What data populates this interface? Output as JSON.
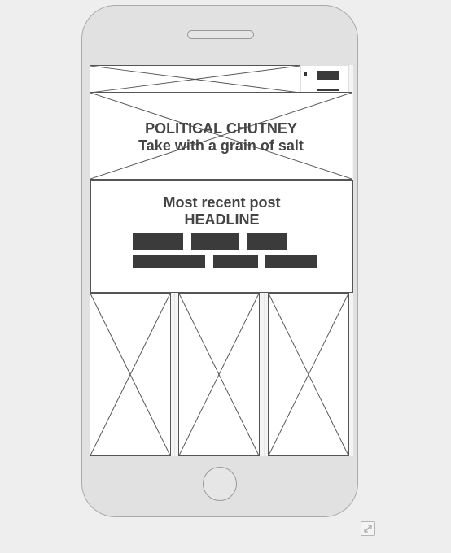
{
  "hero": {
    "title": "POLITICAL CHUTNEY",
    "tagline": "Take with a grain of salt"
  },
  "post": {
    "heading_line1": "Most recent post",
    "heading_line2": "HEADLINE"
  },
  "icons": {
    "resize": "expand-icon"
  },
  "colors": {
    "background": "#eeeeee",
    "device": "#e1e1e1",
    "text": "#444444",
    "block": "#3b3b3b"
  }
}
